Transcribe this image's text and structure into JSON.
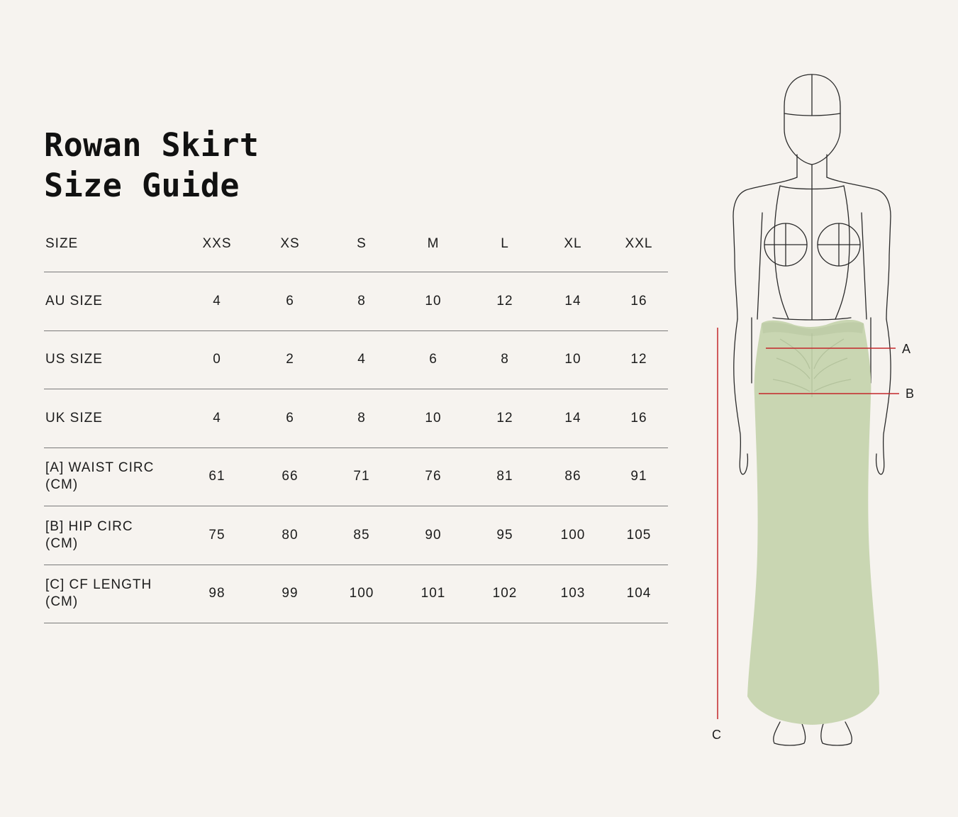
{
  "title": {
    "line1": "Rowan Skirt",
    "line2": "Size Guide"
  },
  "table": {
    "header": {
      "label": "SIZE",
      "cells": [
        "XXS",
        "XS",
        "S",
        "M",
        "L",
        "XL",
        "XXL"
      ]
    },
    "rows": [
      {
        "label": "AU SIZE",
        "cells": [
          "4",
          "6",
          "8",
          "10",
          "12",
          "14",
          "16"
        ]
      },
      {
        "label": "US SIZE",
        "cells": [
          "0",
          "2",
          "4",
          "6",
          "8",
          "10",
          "12"
        ]
      },
      {
        "label": "UK SIZE",
        "cells": [
          "4",
          "6",
          "8",
          "10",
          "12",
          "14",
          "16"
        ]
      },
      {
        "label": "[A] WAIST CIRC (CM)",
        "cells": [
          "61",
          "66",
          "71",
          "76",
          "81",
          "86",
          "91"
        ]
      },
      {
        "label": "[B] HIP CIRC (CM)",
        "cells": [
          "75",
          "80",
          "85",
          "90",
          "95",
          "100",
          "105"
        ]
      },
      {
        "label": "[C] CF LENGTH (CM)",
        "cells": [
          "98",
          "99",
          "100",
          "101",
          "102",
          "103",
          "104"
        ]
      }
    ]
  },
  "figure": {
    "label_a": "A",
    "label_b": "B",
    "label_c": "C",
    "skirt_color": "#c9d6b2",
    "measure_color": "#c4272b"
  }
}
